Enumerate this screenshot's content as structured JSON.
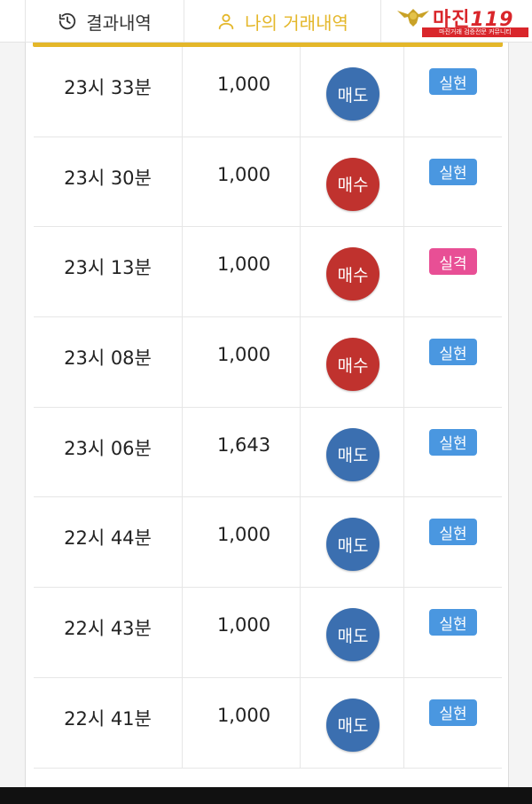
{
  "tabs": {
    "results_label": "결과내역",
    "mytrades_label": "나의 거래내역"
  },
  "watermark": {
    "brand": "마진",
    "brand_num": "119",
    "tagline": "마진거래 검증전문 커뮤니티"
  },
  "colors": {
    "accent": "#e4b72a",
    "sell": "#3b6fb0",
    "buy": "#c0322e",
    "realized": "#4a97e0",
    "failed": "#e84f95"
  },
  "rows": [
    {
      "time": "23시 33분",
      "amount": "1,000",
      "side": "매도",
      "side_type": "sell",
      "result": "실현",
      "result_type": "ok"
    },
    {
      "time": "23시 30분",
      "amount": "1,000",
      "side": "매수",
      "side_type": "buy",
      "result": "실현",
      "result_type": "ok"
    },
    {
      "time": "23시 13분",
      "amount": "1,000",
      "side": "매수",
      "side_type": "buy",
      "result": "실격",
      "result_type": "fail"
    },
    {
      "time": "23시 08분",
      "amount": "1,000",
      "side": "매수",
      "side_type": "buy",
      "result": "실현",
      "result_type": "ok"
    },
    {
      "time": "23시 06분",
      "amount": "1,643",
      "side": "매도",
      "side_type": "sell",
      "result": "실현",
      "result_type": "ok"
    },
    {
      "time": "22시 44분",
      "amount": "1,000",
      "side": "매도",
      "side_type": "sell",
      "result": "실현",
      "result_type": "ok"
    },
    {
      "time": "22시 43분",
      "amount": "1,000",
      "side": "매도",
      "side_type": "sell",
      "result": "실현",
      "result_type": "ok"
    },
    {
      "time": "22시 41분",
      "amount": "1,000",
      "side": "매도",
      "side_type": "sell",
      "result": "실현",
      "result_type": "ok"
    }
  ]
}
